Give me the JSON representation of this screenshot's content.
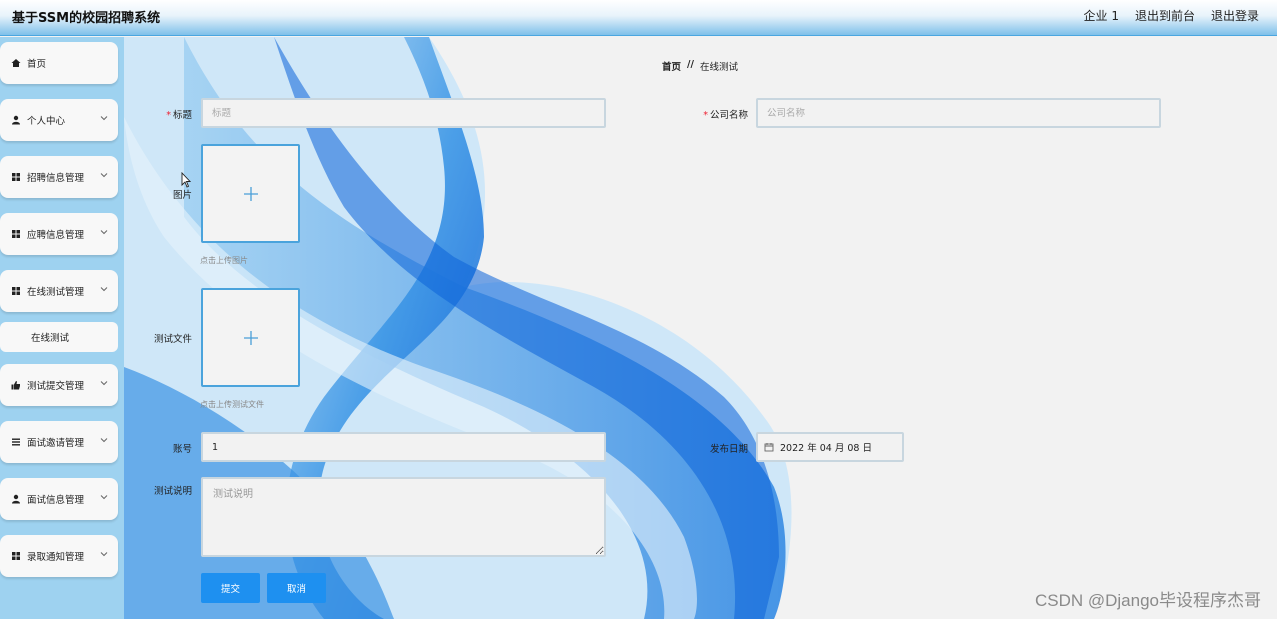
{
  "header": {
    "title": "基于SSM的校园招聘系统",
    "links": [
      "企业 1",
      "退出到前台",
      "退出登录"
    ]
  },
  "sidebar": {
    "items": [
      {
        "label": "首页",
        "icon": "home-icon"
      },
      {
        "label": "个人中心",
        "icon": "person-icon"
      },
      {
        "label": "招聘信息管理",
        "icon": "grid-icon"
      },
      {
        "label": "应聘信息管理",
        "icon": "grid-icon"
      },
      {
        "label": "在线测试管理",
        "icon": "grid-icon"
      },
      {
        "label": "测试提交管理",
        "icon": "thumb-icon"
      },
      {
        "label": "面试邀请管理",
        "icon": "list-icon"
      },
      {
        "label": "面试信息管理",
        "icon": "person-icon"
      },
      {
        "label": "录取通知管理",
        "icon": "grid-icon"
      }
    ],
    "submenu_label": "在线测试"
  },
  "breadcrumb": {
    "home": "首页",
    "separator": "//",
    "current": "在线测试"
  },
  "form": {
    "title_label": "标题",
    "title_placeholder": "标题",
    "company_label": "公司名称",
    "company_placeholder": "公司名称",
    "image_label": "图片",
    "image_hint": "点击上传图片",
    "file_label": "测试文件",
    "file_hint": "点击上传测试文件",
    "account_label": "账号",
    "account_value": "1",
    "date_label": "发布日期",
    "date_value": "2022 年 04 月 08 日",
    "desc_label": "测试说明",
    "desc_placeholder": "测试说明",
    "submit_label": "提交",
    "cancel_label": "取消"
  },
  "watermark": "CSDN @Django毕设程序杰哥",
  "colors": {
    "accent": "#1e90f0",
    "sidebar": "#9ed2f0",
    "header_bottom": "#7fc0ea"
  }
}
